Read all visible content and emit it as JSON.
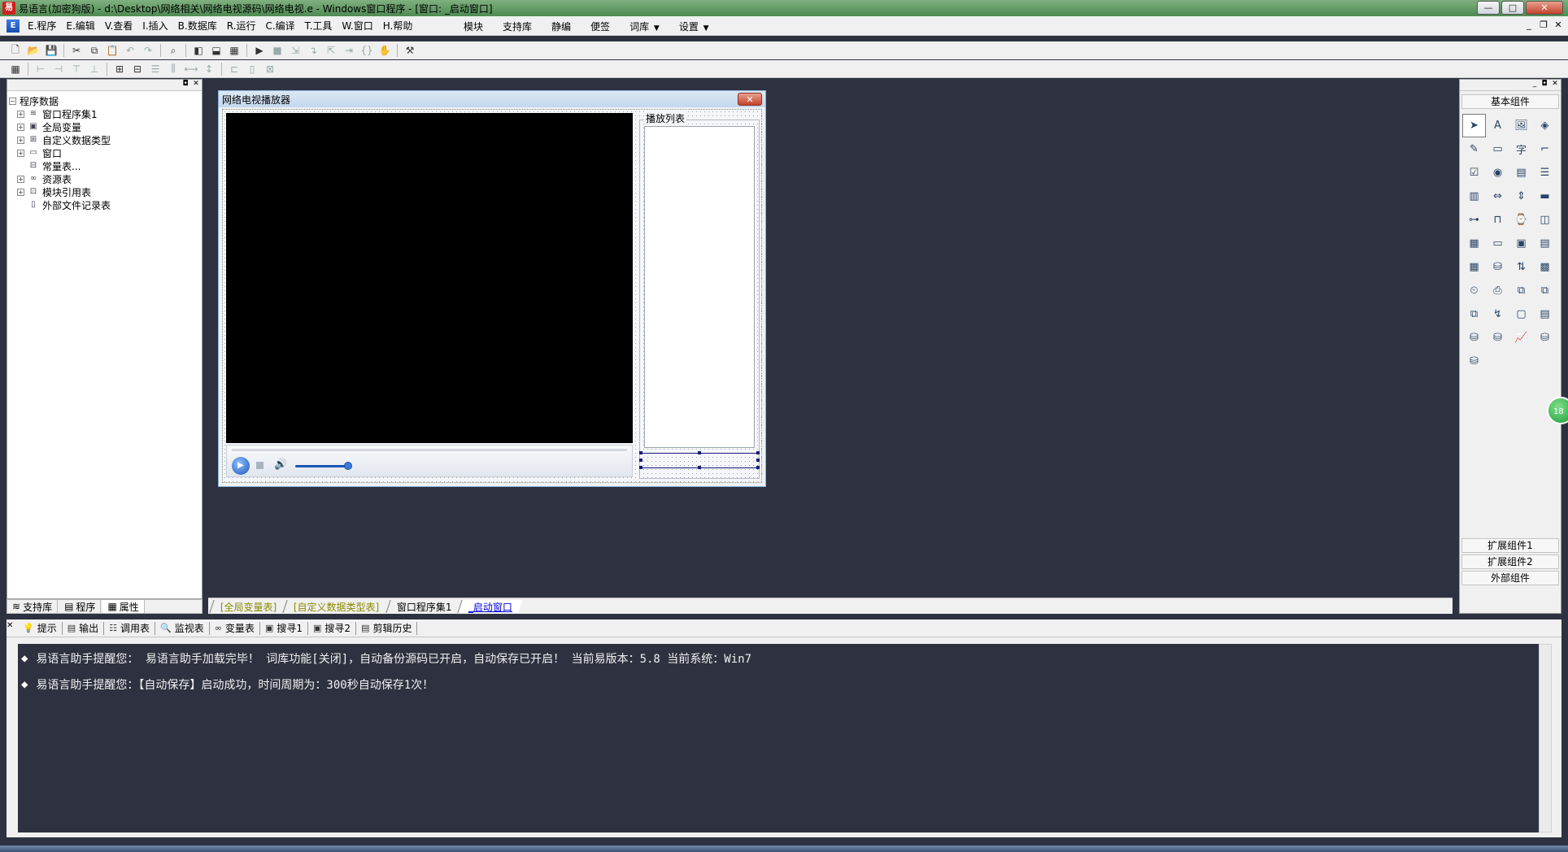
{
  "window": {
    "title": "易语言(加密狗版) - d:\\Desktop\\网络相关\\网络电视源码\\网络电视.e - Windows窗口程序 - [窗口: _启动窗口]",
    "controls": [
      "—",
      "□",
      "✕"
    ]
  },
  "menu": {
    "items": [
      "E.程序",
      "E.编辑",
      "V.查看",
      "I.插入",
      "B.数据库",
      "R.运行",
      "C.编译",
      "T.工具",
      "W.窗口",
      "H.帮助"
    ],
    "right_items": [
      "模块",
      "支持库",
      "静编",
      "便签",
      "词库",
      "设置"
    ]
  },
  "left_panel": {
    "root": "程序数据",
    "nodes": [
      {
        "label": "窗口程序集1",
        "icon": "≋",
        "expandable": true
      },
      {
        "label": "全局变量",
        "icon": "▣",
        "expandable": true
      },
      {
        "label": "自定义数据类型",
        "icon": "⊞",
        "expandable": true
      },
      {
        "label": "窗口",
        "icon": "▭",
        "expandable": true
      },
      {
        "label": "常量表...",
        "icon": "⊟",
        "expandable": false
      },
      {
        "label": "资源表",
        "icon": "∞",
        "expandable": true
      },
      {
        "label": "模块引用表",
        "icon": "⊡",
        "expandable": true
      },
      {
        "label": "外部文件记录表",
        "icon": "▯",
        "expandable": false
      }
    ],
    "tabs": [
      "支持库",
      "程序",
      "属性"
    ]
  },
  "form": {
    "title": "网络电视播放器",
    "close_label": "✕",
    "playlist_label": "播放列表",
    "player": {
      "play": "▶",
      "volume_level": 0.8
    }
  },
  "doc_tabs": [
    "[全局变量表]",
    "[自定义数据类型表]",
    "窗口程序集1",
    "_启动窗口"
  ],
  "right_panel": {
    "header": "基本组件",
    "footers": [
      "扩展组件1",
      "扩展组件2",
      "外部组件"
    ],
    "badge": "18"
  },
  "bottom_panel": {
    "tabs": [
      {
        "label": "提示",
        "icon": "💡"
      },
      {
        "label": "输出",
        "icon": "▤"
      },
      {
        "label": "调用表",
        "icon": "☷"
      },
      {
        "label": "监视表",
        "icon": "🔍"
      },
      {
        "label": "变量表",
        "icon": "∞"
      },
      {
        "label": "搜寻1",
        "icon": "▣"
      },
      {
        "label": "搜寻2",
        "icon": "▣"
      },
      {
        "label": "剪辑历史",
        "icon": "▤"
      }
    ],
    "messages": [
      "易语言助手提醒您：  易语言助手加载完毕！  词库功能[关闭]，自动备份源码已开启，自动保存已开启！  当前易版本：5.8  当前系统：Win7",
      "易语言助手提醒您：【自动保存】启动成功，时间周期为：300秒自动保存1次！"
    ]
  }
}
